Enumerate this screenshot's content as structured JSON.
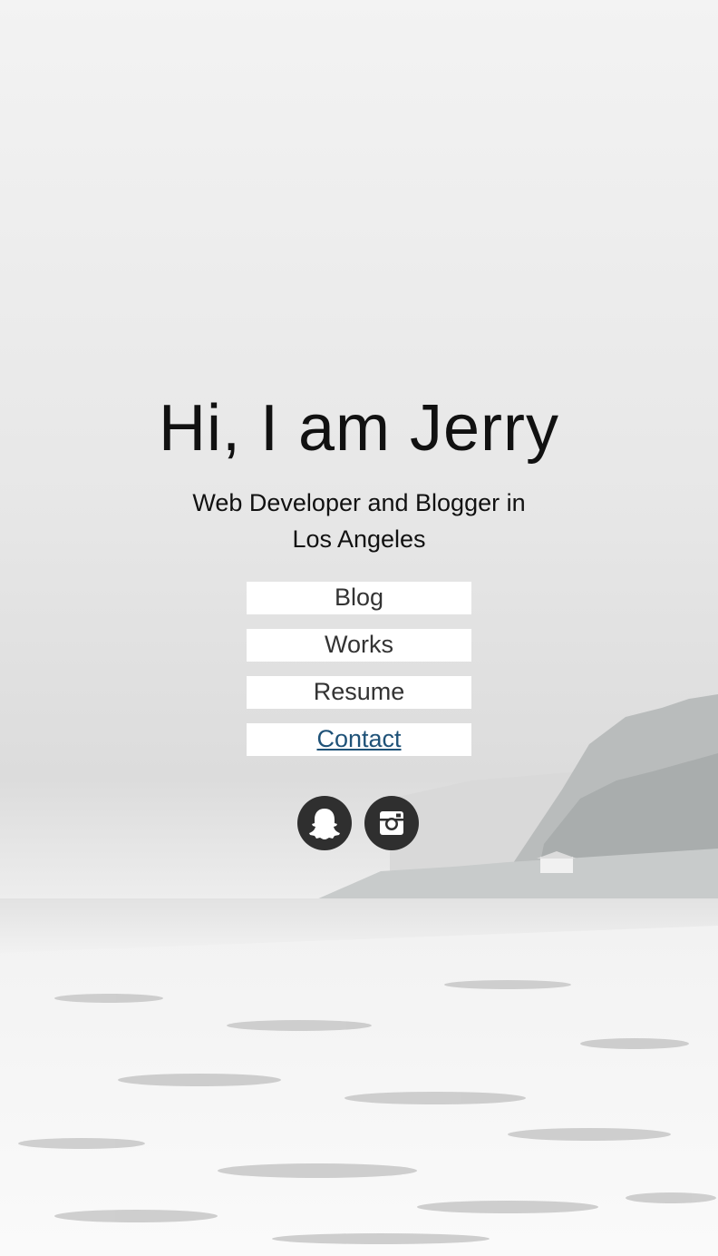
{
  "hero": {
    "title": "Hi, I am Jerry",
    "subtitle": "Web Developer and Blogger in Los Angeles"
  },
  "nav": {
    "items": [
      {
        "label": "Blog",
        "active": false
      },
      {
        "label": "Works",
        "active": false
      },
      {
        "label": "Resume",
        "active": false
      },
      {
        "label": "Contact",
        "active": true
      }
    ]
  },
  "social": {
    "icons": [
      "snapchat-icon",
      "instagram-icon"
    ]
  },
  "colors": {
    "text": "#111111",
    "nav_text": "#333333",
    "active_link": "#1f5278",
    "social_bg": "#2f2f2f",
    "nav_bg": "#ffffff"
  }
}
